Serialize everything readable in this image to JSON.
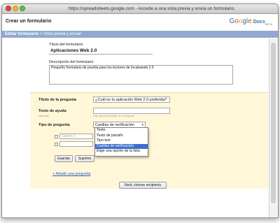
{
  "window": {
    "title": "https://spreadsheets.google.com - Accede a una vista previa y envía un formulario."
  },
  "header": {
    "app_title": "Crear un formulario",
    "logo": {
      "g": "G",
      "o1": "o",
      "o2": "o",
      "g2": "g",
      "l": "l",
      "e": "e",
      "docs": "Docs",
      "beta": "BETA"
    }
  },
  "nav": {
    "current": "Editar formulario",
    "separator": ">",
    "next": "Vista previa y enviar"
  },
  "form": {
    "title_label": "Título del formulario",
    "title_value": "Aplicaciones Web 2.0",
    "desc_label": "Descripción del formulario",
    "desc_value": "Pequeño formulario de prueba para los lectores de Incubaweb 2.0"
  },
  "question": {
    "title_label": "Título de la pregunta",
    "title_value": "¿Cuál es tu aplicación Web 2.0 preferida?",
    "help_label": "Texto de ayuda",
    "help_hint": "(optional)",
    "help_sub": "Este aparecerá debajo de la pregunta",
    "type_label": "Tipo de pregunta",
    "type_selected": "Casillas de verificación",
    "dropdown_options": [
      "Texto",
      "Texto de párrafo",
      "Tipo test",
      "Casillas de verificación",
      "Elige una opción de la lista"
    ],
    "dropdown_selected_index": 3,
    "option1_placeholder": "Opción 1",
    "save_label": "Guardar",
    "delete_label": "Suprimir"
  },
  "footer": {
    "add_question": "+ Añadir una pregunta",
    "next_button": "Next, choose recipients"
  },
  "colors": {
    "nav_bg": "#8fa9d1",
    "question_bg": "#fff7d8",
    "dropdown_selected": "#3d6fcf",
    "link": "#2b59c3"
  }
}
